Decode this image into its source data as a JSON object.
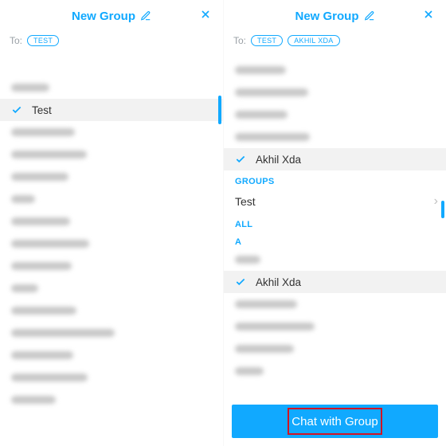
{
  "colors": {
    "accent": "#11A9FF",
    "highlight_border": "#d11324"
  },
  "left": {
    "title": "New Group",
    "to_label": "To:",
    "chips": [
      "TEST"
    ],
    "selected_item": "Test",
    "blur_widths": [
      48,
      80,
      95,
      72,
      30,
      74,
      98,
      76,
      34,
      82,
      130,
      78,
      96,
      56
    ]
  },
  "right": {
    "title": "New Group",
    "to_label": "To:",
    "chips": [
      "TEST",
      "AKHIL XDA"
    ],
    "top_blur_widths": [
      64,
      92,
      66,
      94
    ],
    "selected_top": "Akhil Xda",
    "groups_header": "GROUPS",
    "group_item": "Test",
    "all_header": "ALL",
    "letter": "A",
    "selected_all": "Akhil Xda",
    "bottom_blur_widths": [
      78,
      100,
      74,
      36
    ],
    "cta_label": "Chat with Group"
  },
  "icons": {
    "pencil": "pencil-icon",
    "close": "close-icon",
    "check": "check-icon",
    "chevron": "chevron-right-icon"
  }
}
